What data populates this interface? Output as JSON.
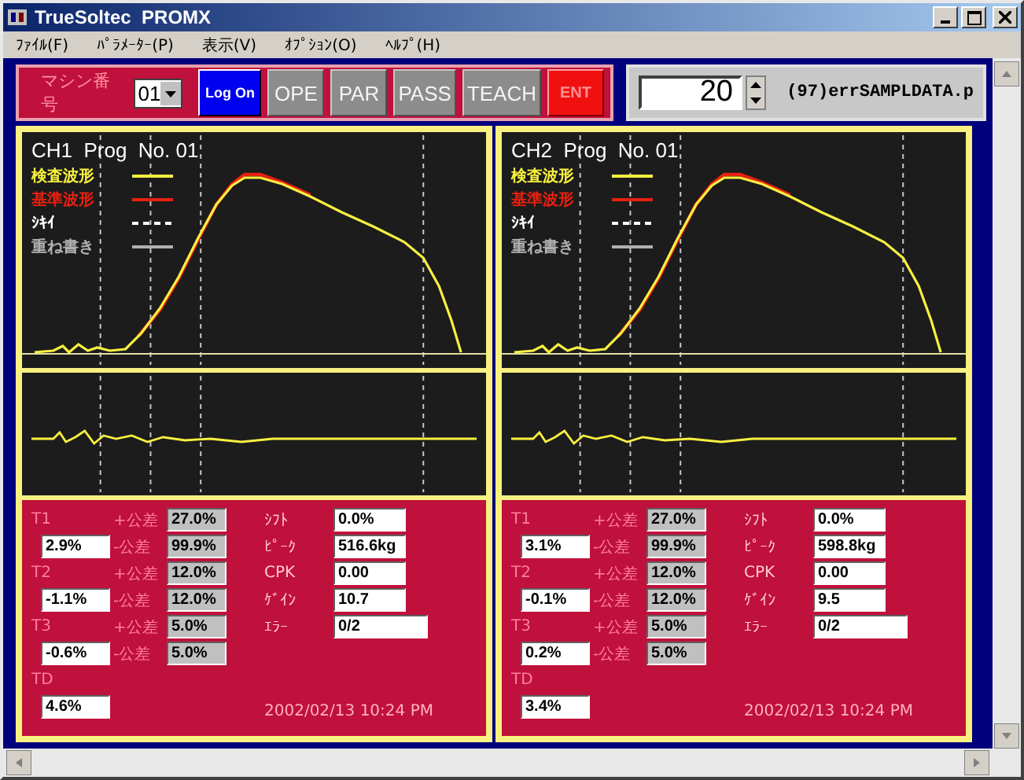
{
  "window": {
    "title": "TrueSoltec  PROMX"
  },
  "menu": [
    "ﾌｧｲﾙ(F)",
    "ﾊﾟﾗﾒｰﾀｰ(P)",
    "表示(V)",
    "ｵﾌﾟｼｮﾝ(O)",
    "ﾍﾙﾌﾟ(H)"
  ],
  "toolbar": {
    "machine_label": "マシン番号",
    "machine_value": "01",
    "buttons": [
      {
        "label": "Log On",
        "kind": "primary"
      },
      {
        "label": "OPE",
        "kind": "disabled"
      },
      {
        "label": "PAR",
        "kind": "disabled"
      },
      {
        "label": "PASS",
        "kind": "disabled"
      },
      {
        "label": "TEACH",
        "kind": "disabled"
      },
      {
        "label": "ENT",
        "kind": "danger"
      }
    ],
    "count_value": "20",
    "file_name": "(97)errSAMPLDATA.p"
  },
  "channels": [
    {
      "title": "CH1  Prog  No. 01",
      "legend": [
        {
          "label": "検査波形",
          "color": "#f8f040",
          "kind": "solid"
        },
        {
          "label": "基準波形",
          "color": "#e82010",
          "kind": "solid"
        },
        {
          "label": "ｼｷｲ",
          "color": "#ffffff",
          "kind": "dashed"
        },
        {
          "label": "重ね書き",
          "color": "#b0b0b0",
          "kind": "solid"
        }
      ],
      "t_values": [
        {
          "label": "T1",
          "value": "2.9%",
          "plus_label": "+公差",
          "plus": "27.0%",
          "minus_label": "-公差",
          "minus": "99.9%"
        },
        {
          "label": "T2",
          "value": "-1.1%",
          "plus_label": "+公差",
          "plus": "12.0%",
          "minus_label": "-公差",
          "minus": "12.0%"
        },
        {
          "label": "T3",
          "value": "-0.6%",
          "plus_label": "+公差",
          "plus": "5.0%",
          "minus_label": "-公差",
          "minus": "5.0%"
        },
        {
          "label": "TD",
          "value": "4.6%"
        }
      ],
      "stats": [
        {
          "label": "ｼﾌﾄ",
          "value": "0.0%"
        },
        {
          "label": "ﾋﾟｰｸ",
          "value": "516.6kg"
        },
        {
          "label": "CPK",
          "value": "0.00"
        },
        {
          "label": "ｹﾞｲﾝ",
          "value": "10.7"
        },
        {
          "label": "ｴﾗｰ",
          "value": "0/2"
        }
      ],
      "timestamp": "2002/02/13 10:24 PM"
    },
    {
      "title": "CH2  Prog  No. 01",
      "legend": [
        {
          "label": "検査波形",
          "color": "#f8f040",
          "kind": "solid"
        },
        {
          "label": "基準波形",
          "color": "#e82010",
          "kind": "solid"
        },
        {
          "label": "ｼｷｲ",
          "color": "#ffffff",
          "kind": "dashed"
        },
        {
          "label": "重ね書き",
          "color": "#b0b0b0",
          "kind": "solid"
        }
      ],
      "t_values": [
        {
          "label": "T1",
          "value": "3.1%",
          "plus_label": "+公差",
          "plus": "27.0%",
          "minus_label": "-公差",
          "minus": "99.9%"
        },
        {
          "label": "T2",
          "value": "-0.1%",
          "plus_label": "+公差",
          "plus": "12.0%",
          "minus_label": "-公差",
          "minus": "12.0%"
        },
        {
          "label": "T3",
          "value": "0.2%",
          "plus_label": "+公差",
          "plus": "5.0%",
          "minus_label": "-公差",
          "minus": "5.0%"
        },
        {
          "label": "TD",
          "value": "3.4%"
        }
      ],
      "stats": [
        {
          "label": "ｼﾌﾄ",
          "value": "0.0%"
        },
        {
          "label": "ﾋﾟｰｸ",
          "value": "598.8kg"
        },
        {
          "label": "CPK",
          "value": "0.00"
        },
        {
          "label": "ｹﾞｲﾝ",
          "value": "9.5"
        },
        {
          "label": "ｴﾗｰ",
          "value": "0/2"
        }
      ],
      "timestamp": "2002/02/13 10:24 PM"
    }
  ]
}
